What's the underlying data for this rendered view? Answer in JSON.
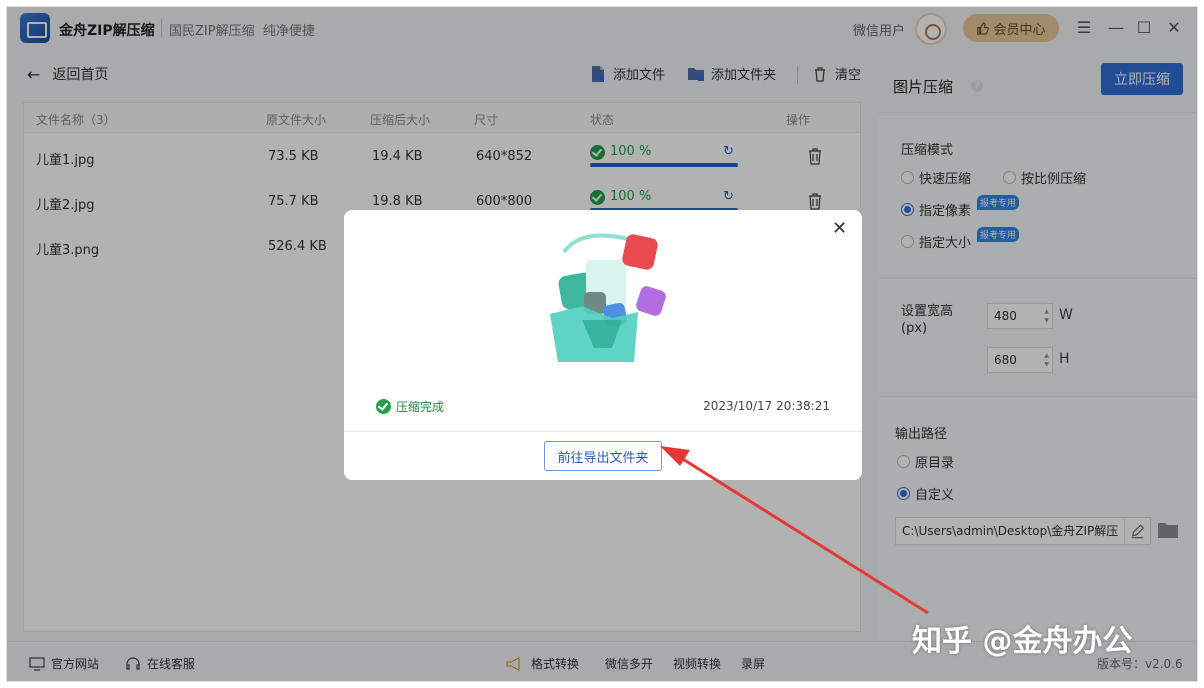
{
  "titlebar": {
    "app_name": "金舟ZIP解压缩",
    "slogan": "国民ZIP解压缩  纯净便捷",
    "user_name": "微信用户",
    "vip_label": "会员中心",
    "menu_icon": "menu-icon",
    "minimize_icon": "minimize-icon",
    "maximize_icon": "maximize-icon",
    "close_icon": "close-icon"
  },
  "toolbar": {
    "back_label": "返回首页",
    "add_file": "添加文件",
    "add_folder": "添加文件夹",
    "clear": "清空"
  },
  "table": {
    "headers": [
      "文件名称（3）",
      "原文件大小",
      "压缩后大小",
      "尺寸",
      "状态",
      "操作"
    ],
    "rows": [
      {
        "name": "儿童1.jpg",
        "orig": "73.5 KB",
        "comp": "19.4 KB",
        "size": "640*852",
        "status": "100 %",
        "progress": 1.0
      },
      {
        "name": "儿童2.jpg",
        "orig": "75.7 KB",
        "comp": "19.8 KB",
        "size": "600*800",
        "status": "100 %",
        "progress": 1.0
      },
      {
        "name": "儿童3.png",
        "orig": "526.4 KB",
        "comp": "",
        "size": "",
        "status": "",
        "progress": 0
      }
    ]
  },
  "right": {
    "title": "图片压缩",
    "help": "?",
    "start_button": "立即压缩",
    "mode_label": "压缩模式",
    "mode_fast": "快速压缩",
    "mode_ratio": "按比例压缩",
    "mode_pixel": "指定像素",
    "mode_size": "指定大小",
    "exam_tag": "报考专用",
    "wh_label": "设置宽高\n(px)",
    "width_value": "480",
    "height_value": "680",
    "width_unit": "W",
    "height_unit": "H",
    "output_label": "输出路径",
    "out_original": "原目录",
    "out_custom": "自定义",
    "out_path": "C:\\Users\\admin\\Desktop\\金舟ZIP解压"
  },
  "footer": {
    "website": "官方网站",
    "service": "在线客服",
    "format": "格式转换",
    "wechat": "微信多开",
    "video": "视频转换",
    "record": "录屏",
    "version": "版本号：v2.0.6"
  },
  "modal": {
    "done_label": "压缩完成",
    "timestamp": "2023/10/17 20:38:21",
    "goto_button": "前往导出文件夹"
  },
  "watermark": "知乎 @金舟办公",
  "colors": {
    "accent": "#2f6fd6",
    "success": "#21a14a",
    "vip": "#e8c79a"
  }
}
